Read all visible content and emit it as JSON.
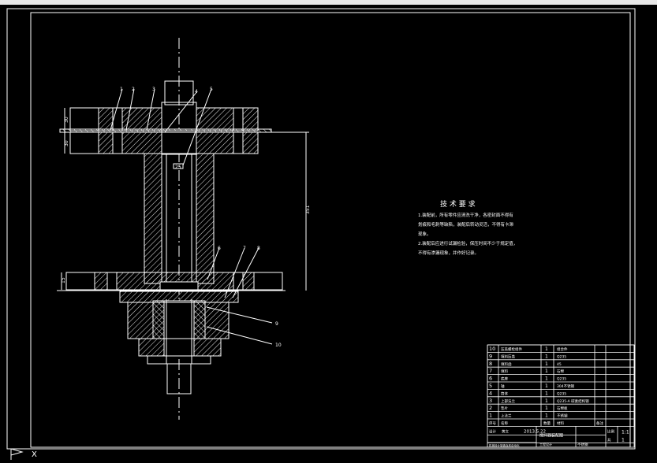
{
  "drawing": {
    "colors": {
      "background": "#000000",
      "line": "#ffffff",
      "hatch": "#ffffff",
      "titlebar": "#e6e6e6"
    },
    "dimensions": {
      "d1": "30",
      "d2": "30",
      "d3": "351",
      "d4": "15",
      "d5": "25"
    },
    "part_callouts": [
      "1",
      "2",
      "3",
      "4",
      "5",
      "6",
      "7",
      "8",
      "9",
      "10"
    ],
    "tech_requirements": {
      "title": "技 术 要 求",
      "lines": [
        "1.装配前，所有零件应清洗干净，各密封面不得有",
        "划痕和毛刺等缺陷，装配后转动灵活，不得有卡滞",
        "现象。",
        "2.装配后应进行试漏检验，保压时间不少于规定值，",
        "不得有渗漏现象，并作好记录。"
      ]
    },
    "bom": {
      "rows": [
        {
          "no": "10",
          "name": "压盖螺栓组件",
          "qty": "1",
          "material": "组合件"
        },
        {
          "no": "9",
          "name": "填料压盖",
          "qty": "1",
          "material": "Q235"
        },
        {
          "no": "8",
          "name": "填料函",
          "qty": "1",
          "material": "45"
        },
        {
          "no": "7",
          "name": "填料",
          "qty": "1",
          "material": "石棉"
        },
        {
          "no": "6",
          "name": "底座",
          "qty": "1",
          "material": "Q235"
        },
        {
          "no": "5",
          "name": "轴",
          "qty": "1",
          "material": "304不锈钢"
        },
        {
          "no": "4",
          "name": "筒体",
          "qty": "1",
          "material": "Q235"
        },
        {
          "no": "3",
          "name": "上部法兰",
          "qty": "1",
          "material": "Q235-A 碳素结构钢"
        },
        {
          "no": "2",
          "name": "垫片",
          "qty": "1",
          "material": "石棉板"
        },
        {
          "no": "1",
          "name": "上法兰",
          "qty": "1",
          "material": "不锈钢"
        }
      ],
      "header": {
        "no": "序号",
        "name": "名称",
        "qty": "数量",
        "material": "材料",
        "note": "备注"
      },
      "title_block": {
        "designer": "设计",
        "designer_name": "黄文",
        "date": "2013.5.22",
        "drawing_title": "搅拌器装配图",
        "scale_label": "比例",
        "scale_value": "1:1",
        "sheet_label": "共",
        "sheet_value": "1",
        "school": "机械设计制造及其自动化",
        "company": "工程设计",
        "material_note": "不锈钢"
      }
    }
  },
  "statusbar": {
    "cursor_icon": "ucs-icon",
    "x_label": "X"
  }
}
